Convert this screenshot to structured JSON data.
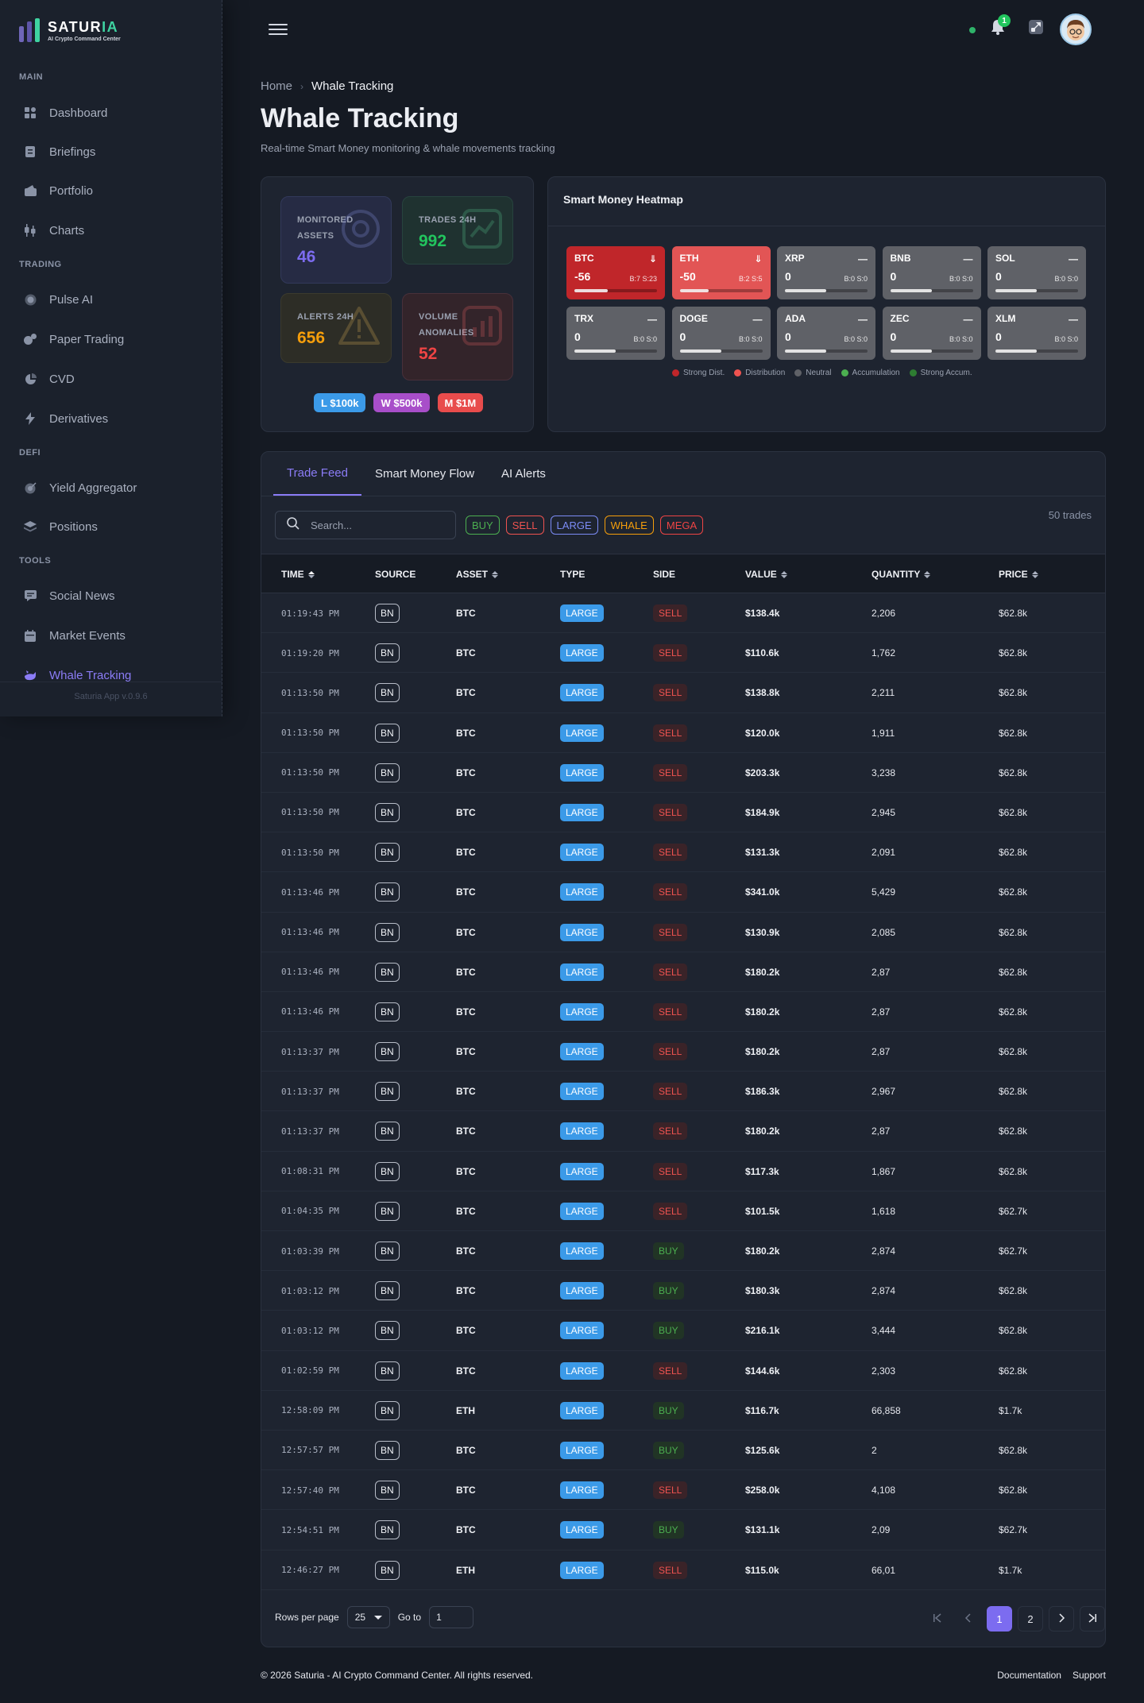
{
  "brand": {
    "name_main": "SATUR",
    "name_accent": "IA",
    "tagline": "AI Crypto Command Center",
    "colors": {
      "accent": "#8b7cf6",
      "brand_green": "#3fd3a1"
    }
  },
  "sidebar": {
    "sections": [
      {
        "label": "MAIN",
        "items": [
          {
            "label": "Dashboard",
            "icon": "grid-icon"
          },
          {
            "label": "Briefings",
            "icon": "document-icon"
          },
          {
            "label": "Portfolio",
            "icon": "wallet-icon"
          },
          {
            "label": "Charts",
            "icon": "candlestick-icon"
          }
        ]
      },
      {
        "label": "TRADING",
        "items": [
          {
            "label": "Pulse AI",
            "icon": "pulse-icon"
          },
          {
            "label": "Paper Trading",
            "icon": "coins-icon"
          },
          {
            "label": "CVD",
            "icon": "pie-icon"
          },
          {
            "label": "Derivatives",
            "icon": "bolt-icon"
          }
        ]
      },
      {
        "label": "DEFI",
        "items": [
          {
            "label": "Yield Aggregator",
            "icon": "target-icon"
          },
          {
            "label": "Positions",
            "icon": "layers-icon"
          }
        ]
      },
      {
        "label": "TOOLS",
        "items": [
          {
            "label": "Social News",
            "icon": "chat-icon"
          },
          {
            "label": "Market Events",
            "icon": "calendar-icon"
          },
          {
            "label": "Whale Tracking",
            "icon": "whale-icon",
            "active": true
          }
        ]
      }
    ],
    "version": "Saturia App v.0.9.6"
  },
  "topbar": {
    "notification_count": "1"
  },
  "header": {
    "breadcrumb_home": "Home",
    "breadcrumb_current": "Whale Tracking",
    "title": "Whale Tracking",
    "subtitle": "Real-time Smart Money monitoring & whale movements tracking"
  },
  "stats": {
    "monitored": {
      "label_line1": "MONITORED",
      "label_line2": "ASSETS",
      "value": "46",
      "color": "#7c6cf0"
    },
    "trades": {
      "label": "TRADES 24H",
      "value": "992",
      "color": "#22c55e"
    },
    "alerts": {
      "label": "ALERTS 24H",
      "value": "656",
      "color": "#f59e0b"
    },
    "volume": {
      "label_line1": "VOLUME",
      "label_line2": "ANOMALIES",
      "value": "52",
      "color": "#ef4444"
    },
    "thresholds": [
      {
        "label": "L $100k",
        "color": "#3b9ae8"
      },
      {
        "label": "W $500k",
        "color": "#a84ec9"
      },
      {
        "label": "M $1M",
        "color": "#e84c4c"
      }
    ]
  },
  "heatmap": {
    "title": "Smart Money Heatmap",
    "tiles": [
      {
        "symbol": "BTC",
        "score": "-56",
        "bs": "B:7 S:23",
        "icon": "⇓",
        "level": 0.4,
        "color": "#c0262a"
      },
      {
        "symbol": "ETH",
        "score": "-50",
        "bs": "B:2 S:5",
        "icon": "⇓",
        "level": 0.35,
        "color": "#e25555"
      },
      {
        "symbol": "XRP",
        "score": "0",
        "bs": "B:0 S:0",
        "icon": "—",
        "level": 0.5,
        "color": "#5f6167"
      },
      {
        "symbol": "BNB",
        "score": "0",
        "bs": "B:0 S:0",
        "icon": "—",
        "level": 0.5,
        "color": "#5f6167"
      },
      {
        "symbol": "SOL",
        "score": "0",
        "bs": "B:0 S:0",
        "icon": "—",
        "level": 0.5,
        "color": "#5f6167"
      },
      {
        "symbol": "TRX",
        "score": "0",
        "bs": "B:0 S:0",
        "icon": "—",
        "level": 0.5,
        "color": "#5f6167"
      },
      {
        "symbol": "DOGE",
        "score": "0",
        "bs": "B:0 S:0",
        "icon": "—",
        "level": 0.5,
        "color": "#5f6167"
      },
      {
        "symbol": "ADA",
        "score": "0",
        "bs": "B:0 S:0",
        "icon": "—",
        "level": 0.5,
        "color": "#5f6167"
      },
      {
        "symbol": "ZEC",
        "score": "0",
        "bs": "B:0 S:0",
        "icon": "—",
        "level": 0.5,
        "color": "#5f6167"
      },
      {
        "symbol": "XLM",
        "score": "0",
        "bs": "B:0 S:0",
        "icon": "—",
        "level": 0.5,
        "color": "#5f6167"
      }
    ],
    "legend": [
      {
        "label": "Strong Dist.",
        "color": "#c0262a"
      },
      {
        "label": "Distribution",
        "color": "#ef5350"
      },
      {
        "label": "Neutral",
        "color": "#5f6167"
      },
      {
        "label": "Accumulation",
        "color": "#4caf50"
      },
      {
        "label": "Strong Accum.",
        "color": "#2e7d32"
      }
    ]
  },
  "feed": {
    "tabs": [
      "Trade Feed",
      "Smart Money Flow",
      "AI Alerts"
    ],
    "search_placeholder": "Search...",
    "filters": [
      {
        "label": "BUY",
        "color": "#4caf50"
      },
      {
        "label": "SELL",
        "color": "#ef5350"
      },
      {
        "label": "LARGE",
        "color": "#7c8cf6"
      },
      {
        "label": "WHALE",
        "color": "#f59e0b"
      },
      {
        "label": "MEGA",
        "color": "#ef4444"
      }
    ],
    "trade_count": "50 trades",
    "columns": [
      "TIME",
      "SOURCE",
      "ASSET",
      "TYPE",
      "SIDE",
      "VALUE",
      "QUANTITY",
      "PRICE"
    ],
    "rows": [
      [
        "01:19:43 PM",
        "BN",
        "BTC",
        "LARGE",
        "SELL",
        "$138.4k",
        "2,206",
        "$62.8k"
      ],
      [
        "01:19:20 PM",
        "BN",
        "BTC",
        "LARGE",
        "SELL",
        "$110.6k",
        "1,762",
        "$62.8k"
      ],
      [
        "01:13:50 PM",
        "BN",
        "BTC",
        "LARGE",
        "SELL",
        "$138.8k",
        "2,211",
        "$62.8k"
      ],
      [
        "01:13:50 PM",
        "BN",
        "BTC",
        "LARGE",
        "SELL",
        "$120.0k",
        "1,911",
        "$62.8k"
      ],
      [
        "01:13:50 PM",
        "BN",
        "BTC",
        "LARGE",
        "SELL",
        "$203.3k",
        "3,238",
        "$62.8k"
      ],
      [
        "01:13:50 PM",
        "BN",
        "BTC",
        "LARGE",
        "SELL",
        "$184.9k",
        "2,945",
        "$62.8k"
      ],
      [
        "01:13:50 PM",
        "BN",
        "BTC",
        "LARGE",
        "SELL",
        "$131.3k",
        "2,091",
        "$62.8k"
      ],
      [
        "01:13:46 PM",
        "BN",
        "BTC",
        "LARGE",
        "SELL",
        "$341.0k",
        "5,429",
        "$62.8k"
      ],
      [
        "01:13:46 PM",
        "BN",
        "BTC",
        "LARGE",
        "SELL",
        "$130.9k",
        "2,085",
        "$62.8k"
      ],
      [
        "01:13:46 PM",
        "BN",
        "BTC",
        "LARGE",
        "SELL",
        "$180.2k",
        "2,87",
        "$62.8k"
      ],
      [
        "01:13:46 PM",
        "BN",
        "BTC",
        "LARGE",
        "SELL",
        "$180.2k",
        "2,87",
        "$62.8k"
      ],
      [
        "01:13:37 PM",
        "BN",
        "BTC",
        "LARGE",
        "SELL",
        "$180.2k",
        "2,87",
        "$62.8k"
      ],
      [
        "01:13:37 PM",
        "BN",
        "BTC",
        "LARGE",
        "SELL",
        "$186.3k",
        "2,967",
        "$62.8k"
      ],
      [
        "01:13:37 PM",
        "BN",
        "BTC",
        "LARGE",
        "SELL",
        "$180.2k",
        "2,87",
        "$62.8k"
      ],
      [
        "01:08:31 PM",
        "BN",
        "BTC",
        "LARGE",
        "SELL",
        "$117.3k",
        "1,867",
        "$62.8k"
      ],
      [
        "01:04:35 PM",
        "BN",
        "BTC",
        "LARGE",
        "SELL",
        "$101.5k",
        "1,618",
        "$62.7k"
      ],
      [
        "01:03:39 PM",
        "BN",
        "BTC",
        "LARGE",
        "BUY",
        "$180.2k",
        "2,874",
        "$62.7k"
      ],
      [
        "01:03:12 PM",
        "BN",
        "BTC",
        "LARGE",
        "BUY",
        "$180.3k",
        "2,874",
        "$62.8k"
      ],
      [
        "01:03:12 PM",
        "BN",
        "BTC",
        "LARGE",
        "BUY",
        "$216.1k",
        "3,444",
        "$62.8k"
      ],
      [
        "01:02:59 PM",
        "BN",
        "BTC",
        "LARGE",
        "SELL",
        "$144.6k",
        "2,303",
        "$62.8k"
      ],
      [
        "12:58:09 PM",
        "BN",
        "ETH",
        "LARGE",
        "BUY",
        "$116.7k",
        "66,858",
        "$1.7k"
      ],
      [
        "12:57:57 PM",
        "BN",
        "BTC",
        "LARGE",
        "BUY",
        "$125.6k",
        "2",
        "$62.8k"
      ],
      [
        "12:57:40 PM",
        "BN",
        "BTC",
        "LARGE",
        "SELL",
        "$258.0k",
        "4,108",
        "$62.8k"
      ],
      [
        "12:54:51 PM",
        "BN",
        "BTC",
        "LARGE",
        "BUY",
        "$131.1k",
        "2,09",
        "$62.7k"
      ],
      [
        "12:46:27 PM",
        "BN",
        "ETH",
        "LARGE",
        "SELL",
        "$115.0k",
        "66,01",
        "$1.7k"
      ]
    ],
    "pagination": {
      "rows_per_page_label": "Rows per page",
      "rows_per_page": "25",
      "goto_label": "Go to",
      "goto_value": "1",
      "pages": [
        "1",
        "2"
      ],
      "current_page": "1"
    }
  },
  "footer": {
    "copyright": "© 2026 Saturia - AI Crypto Command Center. All rights reserved.",
    "links": [
      "Documentation",
      "Support"
    ]
  }
}
